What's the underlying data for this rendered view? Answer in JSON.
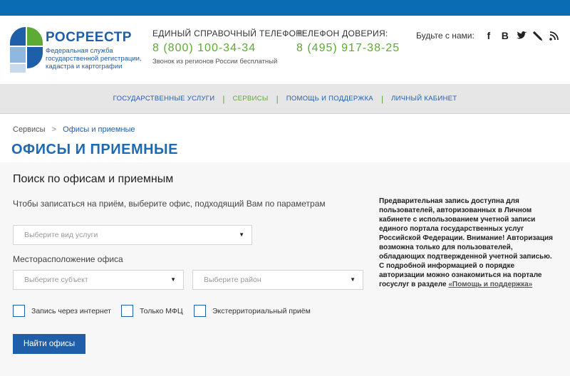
{
  "brand": {
    "name": "РОСРЕЕСТР",
    "subtitle_lines": [
      "Федеральная служба",
      "государственной регистрации,",
      "кадастра и картографии"
    ]
  },
  "header": {
    "hotline": {
      "label": "ЕДИНЫЙ СПРАВОЧНЫЙ ТЕЛЕФОН:",
      "number": "8 (800) 100-34-34",
      "note": "Звонок из регионов России бесплатный"
    },
    "trust": {
      "label": "ТЕЛЕФОН ДОВЕРИЯ:",
      "number": "8 (495) 917-38-25"
    },
    "social": {
      "label": "Будьте с нами:",
      "icons": [
        "facebook-icon",
        "vk-icon",
        "twitter-icon",
        "livejournal-icon",
        "rss-icon"
      ],
      "glyphs": [
        "f",
        "B",
        "🐦",
        "✎",
        "⚡"
      ]
    }
  },
  "nav": {
    "items": [
      {
        "label": "ГОСУДАРСТВЕННЫЕ УСЛУГИ",
        "active": false
      },
      {
        "label": "СЕРВИСЫ",
        "active": true
      },
      {
        "label": "ПОМОЩЬ И ПОДДЕРЖКА",
        "active": false
      },
      {
        "label": "ЛИЧНЫЙ КАБИНЕТ",
        "active": false
      }
    ],
    "separator": "|"
  },
  "breadcrumb": {
    "root": "Сервисы",
    "separator": ">",
    "current": "Офисы и приемные"
  },
  "page": {
    "title": "ОФИСЫ И ПРИЕМНЫЕ"
  },
  "search": {
    "title": "Поиск по офисам и приемным",
    "hint": "Чтобы записаться на приём, выберите офис, подходящий Вам по параметрам",
    "service_select": "Выберите вид услуги",
    "location_label": "Месторасположение офиса",
    "region_select": "Выберите субъект",
    "district_select": "Выберите район",
    "dropdown_arrow": "▼",
    "checkboxes": [
      {
        "label": "Запись через интернет",
        "checked": false
      },
      {
        "label": "Только МФЦ",
        "checked": false
      },
      {
        "label": "Экстерриториальный приём",
        "checked": false
      }
    ],
    "submit_label": "Найти офисы"
  },
  "info": {
    "text": "Предварительная запись доступна для пользователей, авторизованных в Личном кабинете с использованием учетной записи единого портала государственных услуг Российской Федерации. Внимание! Авторизация возможна только для пользователей, обладающих подтвержденной учетной записью. С подробной информацией о порядке авторизации можно ознакомиться на портале госуслуг в разделе ",
    "link": "«Помощь и поддержка»"
  },
  "colors": {
    "brand_blue": "#1f5ea8",
    "top_bar": "#0a6db3",
    "accent_green": "#5daa34",
    "nav_bg": "#e6e6e6"
  }
}
